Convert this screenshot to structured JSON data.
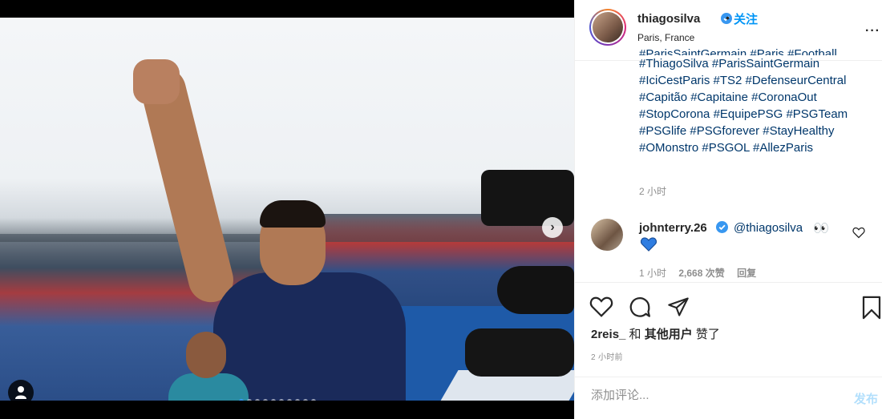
{
  "post": {
    "author": {
      "username": "thiagosilva",
      "follow_label": "关注",
      "location": "Paris, France"
    },
    "caption": {
      "clipped_line": "#ParisSaintGermain #Paris #Football",
      "lines": [
        "#ThiagoSilva #ParisSaintGermain",
        "#IciCestParis #TS2 #DefenseurCentral",
        "#Capitão #Capitaine #CoronaOut",
        "#StopCorona #EquipePSG #PSGTeam",
        "#PSGlife #PSGforever #StayHealthy",
        "#OMonstro #PSGOL #AllezParis"
      ],
      "time": "2 小时"
    },
    "comment": {
      "username": "johnterry.26",
      "mention": "@thiagosilva",
      "emoji": "👀",
      "heart_emoji": "💙",
      "time": "1 小时",
      "likes": "2,668 次赞",
      "reply_label": "回复"
    },
    "likes": {
      "first_user": "2reis_",
      "joiner": "和",
      "others": "其他用户",
      "suffix": "赞了"
    },
    "time_ago": "2 小时前",
    "add_comment": {
      "placeholder": "添加评论...",
      "post_label": "发布"
    },
    "media": {
      "carousel_count": 10,
      "carousel_active_index": 0
    }
  },
  "colors": {
    "link": "#00376b",
    "accent": "#0095f6",
    "muted": "#8e8e8e",
    "text": "#262626",
    "post_disabled": "#b2dffc",
    "dot_active": "#3897f0"
  },
  "icons": {
    "header_more": "more-dots-icon",
    "verified": "verified-badge-icon",
    "like": "heart-outline-icon",
    "comment": "comment-bubble-icon",
    "share": "paper-plane-icon",
    "save": "bookmark-icon",
    "comment_like": "small-heart-icon",
    "carousel_next": "chevron-right-icon",
    "tags": "user-tag-icon"
  }
}
